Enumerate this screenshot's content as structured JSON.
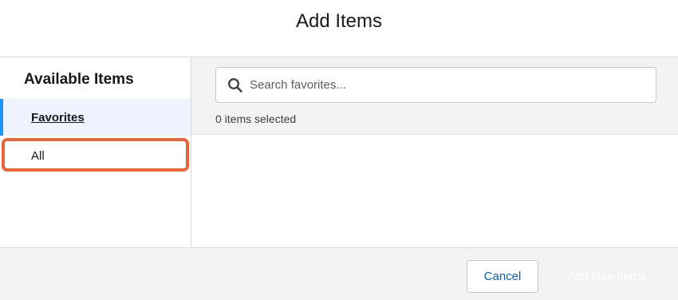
{
  "header": {
    "title": "Add Items"
  },
  "sidebar": {
    "heading": "Available Items",
    "items": [
      {
        "label": "Favorites",
        "active": true
      },
      {
        "label": "All",
        "active": false
      }
    ]
  },
  "search": {
    "placeholder": "Search favorites...",
    "value": "",
    "selected_count": "0 items selected"
  },
  "footer": {
    "cancel_label": "Cancel",
    "add_label": "Add Nav Items"
  },
  "colors": {
    "accent": "#1b96ff",
    "highlight": "#e2673e",
    "link": "#0b5cab"
  }
}
